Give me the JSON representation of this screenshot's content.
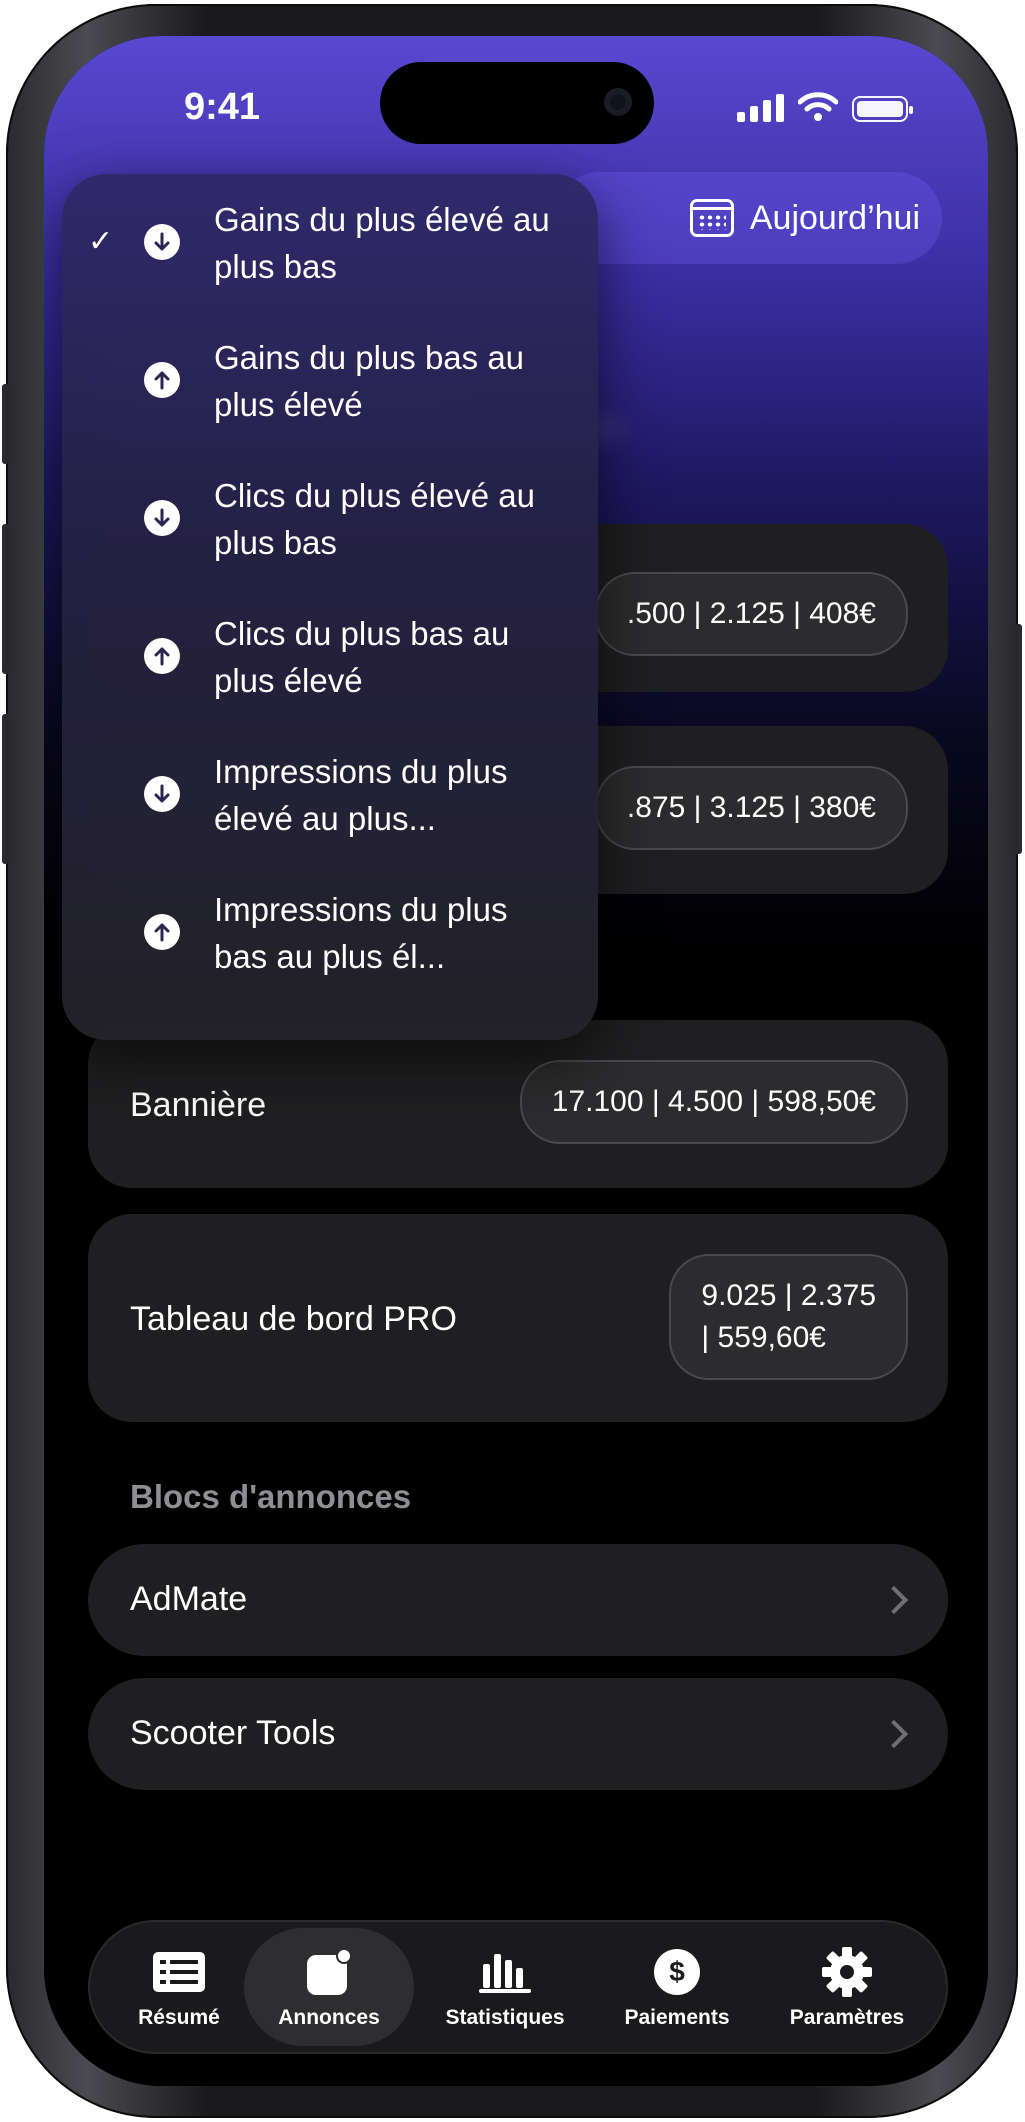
{
  "status_bar": {
    "time": "9:41"
  },
  "header": {
    "date_filter_label": "Aujourd’hui"
  },
  "sort_menu": {
    "items": [
      {
        "label": "Gains du plus élevé au plus bas",
        "direction": "down",
        "selected": true
      },
      {
        "label": "Gains du plus bas au plus élevé",
        "direction": "up",
        "selected": false
      },
      {
        "label": "Clics du plus élevé au plus bas",
        "direction": "down",
        "selected": false
      },
      {
        "label": "Clics du plus bas au plus élevé",
        "direction": "up",
        "selected": false
      },
      {
        "label": "Impressions du plus élevé au plus...",
        "direction": "down",
        "selected": false
      },
      {
        "label": "Impressions du plus bas au plus él...",
        "direction": "up",
        "selected": false
      }
    ],
    "check_mark": "✓"
  },
  "ad_types": [
    {
      "label": "",
      "stats": ".500 | 2.125 | 408€"
    },
    {
      "label": "",
      "stats": ".875 | 3.125 | 380€"
    },
    {
      "label": "Bannière",
      "stats": "17.100 | 4.500 | 598,50€"
    },
    {
      "label": "Tableau de bord PRO",
      "stats_line1": "9.025 | 2.375",
      "stats_line2": "| 559,60€"
    }
  ],
  "ad_blocks": {
    "section_title": "Blocs d'annonces",
    "items": [
      {
        "label": "AdMate"
      },
      {
        "label": "Scooter Tools"
      }
    ]
  },
  "tab_bar": {
    "tabs": [
      {
        "label": "Résumé",
        "icon": "list-icon"
      },
      {
        "label": "Annonces",
        "icon": "ad-icon",
        "active": true
      },
      {
        "label": "Statistiques",
        "icon": "bar-chart-icon"
      },
      {
        "label": "Paiements",
        "icon": "dollar-icon"
      },
      {
        "label": "Paramètres",
        "icon": "gear-icon"
      }
    ]
  },
  "colors": {
    "accent_top": "#5a48d0",
    "card_bg": "#1f1f21",
    "muted_text": "#8e8e93"
  }
}
